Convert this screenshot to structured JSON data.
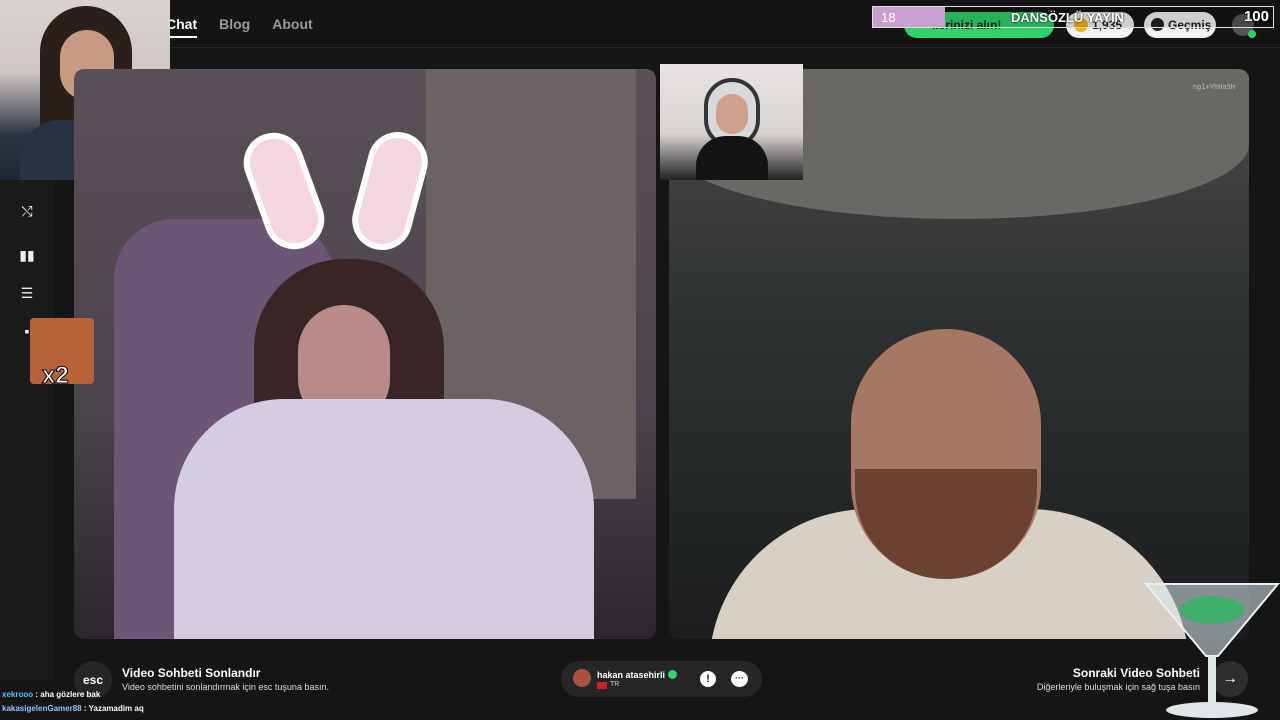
{
  "nav": {
    "items": [
      {
        "label": "Chat",
        "active": true
      },
      {
        "label": "Blog"
      },
      {
        "label": "About"
      }
    ]
  },
  "header": {
    "promo_label": "llerinizi alın!",
    "coins_value": "1,935",
    "history_label": "Geçmiş"
  },
  "stream_overlay": {
    "current_count": "18",
    "label": "DANSÖZLÜ YAYIN",
    "goal": "100",
    "progress_fraction": 0.18,
    "colors": {
      "fill": "#c9a0cf"
    }
  },
  "emote": {
    "multiplier": "x2"
  },
  "video_right": {
    "tag": "ng1+YhHa9H"
  },
  "controls": {
    "esc_label": "esc",
    "end_title": "Video Sohbeti Sonlandır",
    "end_desc": "Video sohbetini sonlandırmak için esc tuşuna basın.",
    "peer_name": "hakan atasehirli",
    "peer_country": "TR",
    "next_title": "Sonraki Video Sohbeti",
    "next_desc": "Diğerleriyle buluşmak için sağ tuşa basın"
  },
  "chat_log": [
    {
      "user": "xekrooo",
      "message": "aha gözlere bak"
    },
    {
      "user": "kakasigelenGamer88",
      "message": "Yazamadim aq"
    }
  ],
  "colors": {
    "accent_green": "#2fd36b",
    "background": "#151515"
  }
}
